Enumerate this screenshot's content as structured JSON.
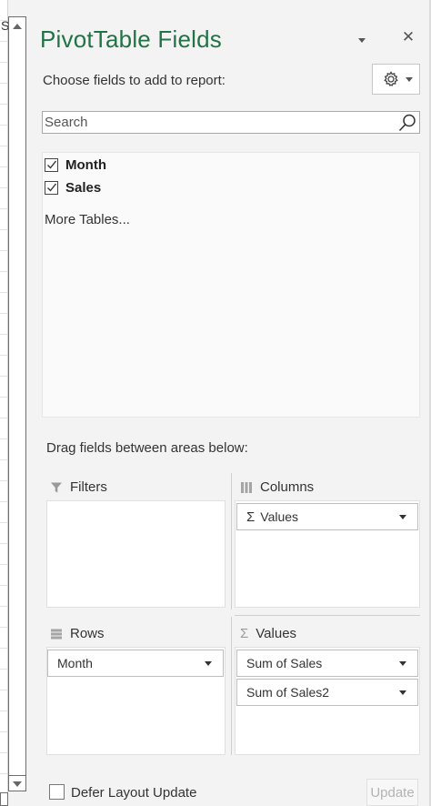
{
  "sheet": {
    "cell_fragment": "S"
  },
  "pane": {
    "title": "PivotTable Fields",
    "choose_label": "Choose fields to add to report:",
    "tools_icon": "gear-icon",
    "accent_color": "#217346"
  },
  "search": {
    "placeholder": "Search"
  },
  "fields": [
    {
      "label": "Month",
      "checked": true
    },
    {
      "label": "Sales",
      "checked": true
    }
  ],
  "more_tables": "More Tables...",
  "drag_label": "Drag fields between areas below:",
  "areas": {
    "filters": {
      "label": "Filters",
      "icon": "filter-icon",
      "items": []
    },
    "columns": {
      "label": "Columns",
      "icon": "columns-icon",
      "items": [
        "Values"
      ]
    },
    "rows": {
      "label": "Rows",
      "icon": "rows-icon",
      "items": [
        "Month"
      ]
    },
    "values": {
      "label": "Values",
      "icon": "sigma-icon",
      "items": [
        "Sum of Sales",
        "Sum of Sales2"
      ]
    }
  },
  "footer": {
    "defer_label": "Defer Layout Update",
    "update_label": "Update"
  }
}
